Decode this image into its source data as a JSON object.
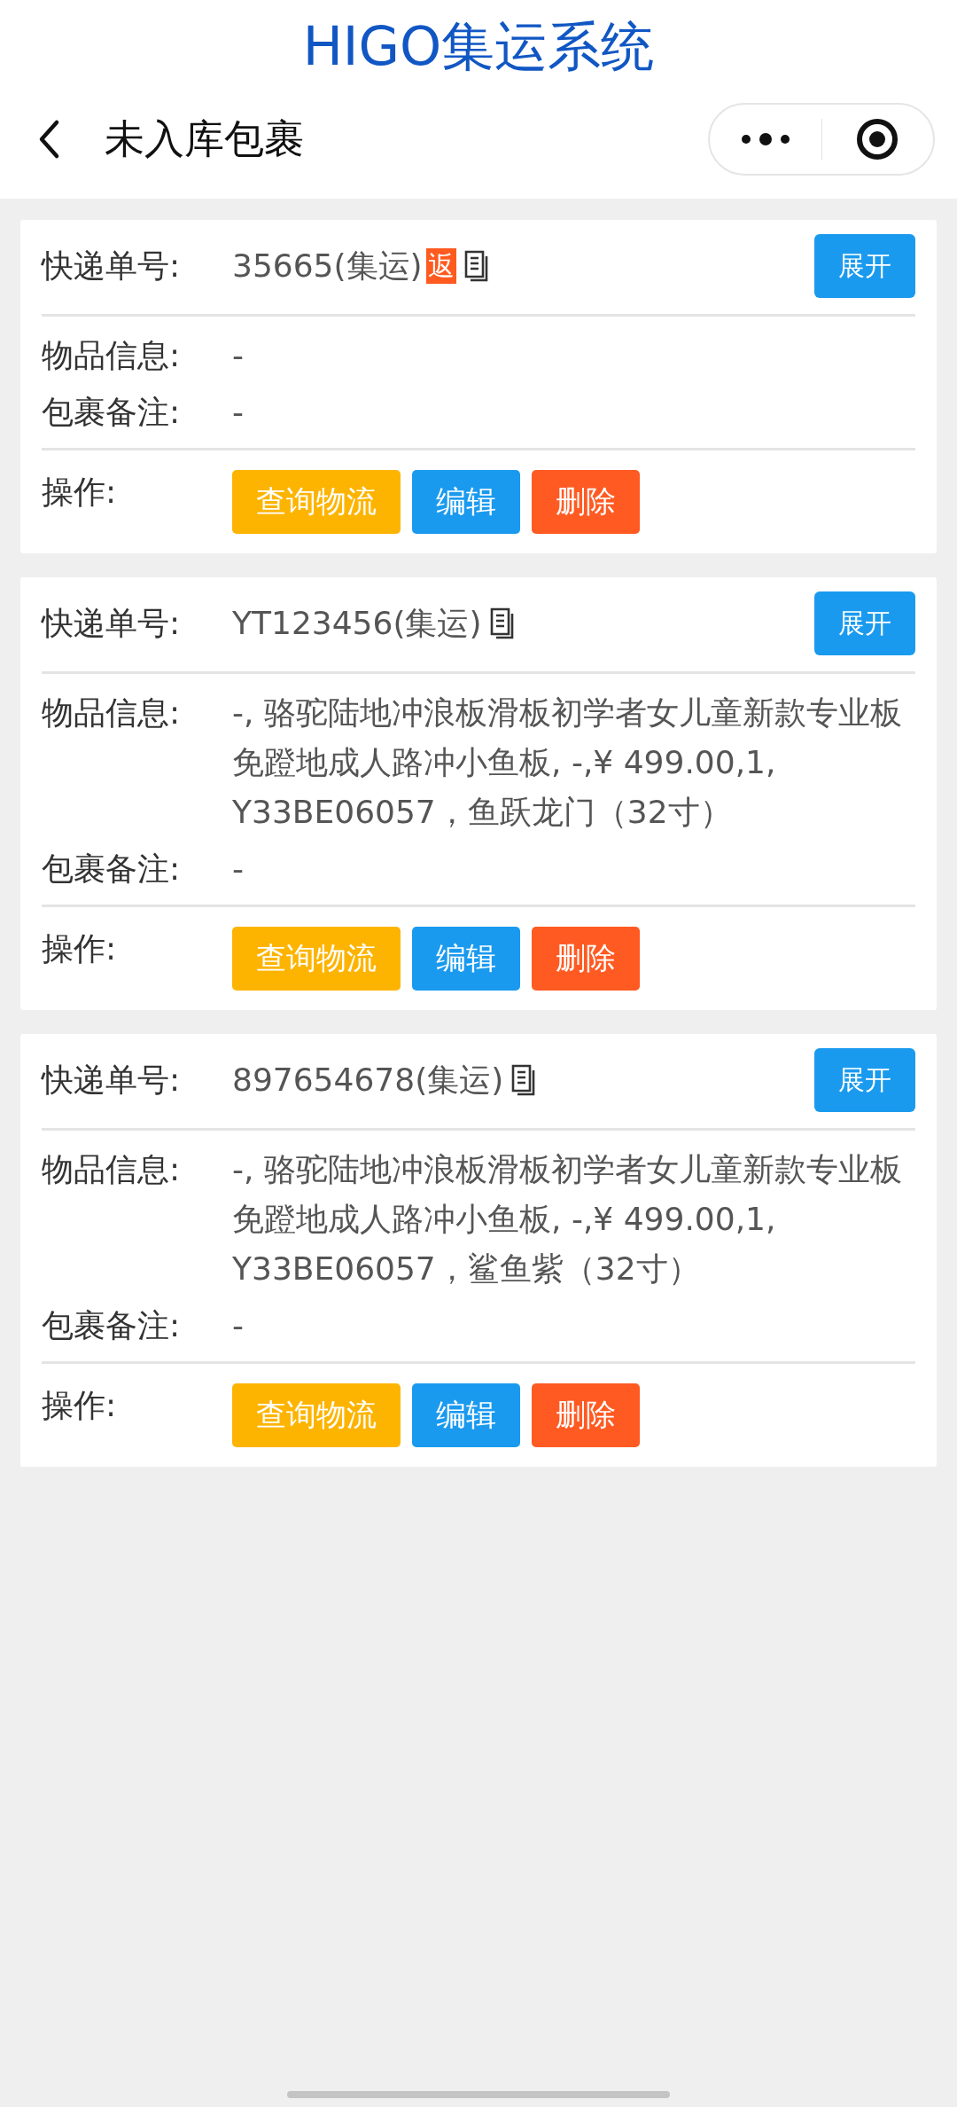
{
  "app_title": "HIGO集运系统",
  "nav": {
    "title": "未入库包裹"
  },
  "packages": [
    {
      "tracking_label": "快递单号:",
      "tracking_number": "35665(集运)",
      "return_badge": "返",
      "expand_button": "展开",
      "item_label": "物品信息:",
      "item_info": "-",
      "note_label": "包裹备注:",
      "note": "-",
      "actions_label": "操作:",
      "actions": [
        "查询物流",
        "编辑",
        "删除"
      ]
    },
    {
      "tracking_label": "快递单号:",
      "tracking_number": "YT123456(集运)",
      "expand_button": "展开",
      "item_label": "物品信息:",
      "item_info": "-, 骆驼陆地冲浪板滑板初学者女儿童新款专业板免蹬地成人路冲小鱼板, -,¥ 499.00,1, Y33BE06057，鱼跃龙门（32寸）",
      "note_label": "包裹备注:",
      "note": "-",
      "actions_label": "操作:",
      "actions": [
        "查询物流",
        "编辑",
        "删除"
      ]
    },
    {
      "tracking_label": "快递单号:",
      "tracking_number": "897654678(集运)",
      "expand_button": "展开",
      "item_label": "物品信息:",
      "item_info": "-, 骆驼陆地冲浪板滑板初学者女儿童新款专业板免蹬地成人路冲小鱼板, -,¥ 499.00,1, Y33BE06057，鲨鱼紫（32寸）",
      "note_label": "包裹备注:",
      "note": "-",
      "actions_label": "操作:",
      "actions": [
        "查询物流",
        "编辑",
        "删除"
      ]
    }
  ]
}
